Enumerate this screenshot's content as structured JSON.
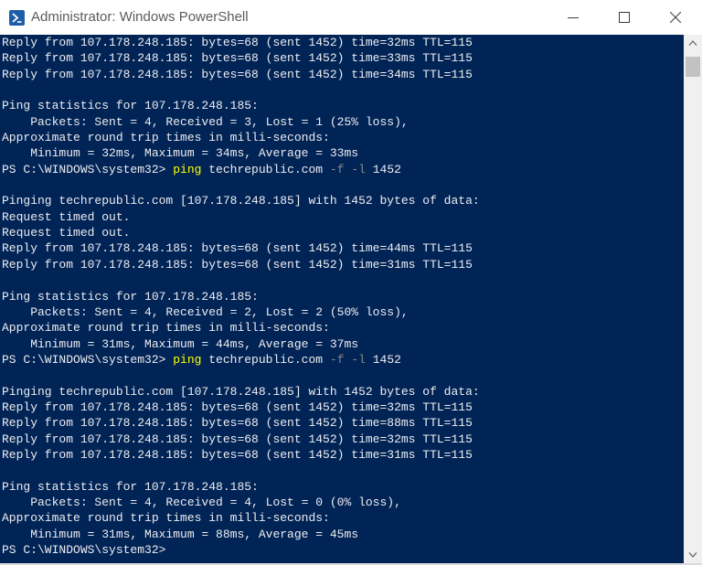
{
  "window": {
    "title": "Administrator: Windows PowerShell",
    "app_icon": "powershell-icon",
    "controls": [
      "minimize-icon",
      "maximize-icon",
      "close-icon"
    ]
  },
  "colors": {
    "console_background": "#012456",
    "console_text": "#eeedf0",
    "command_highlight": "#ffff00",
    "parameter_text": "#8a8a8a"
  },
  "console": {
    "lines": [
      "Reply from 107.178.248.185: bytes=68 (sent 1452) time=32ms TTL=115",
      "Reply from 107.178.248.185: bytes=68 (sent 1452) time=33ms TTL=115",
      "Reply from 107.178.248.185: bytes=68 (sent 1452) time=34ms TTL=115",
      "",
      "Ping statistics for 107.178.248.185:",
      "    Packets: Sent = 4, Received = 3, Lost = 1 (25% loss),",
      "Approximate round trip times in milli-seconds:",
      "    Minimum = 32ms, Maximum = 34ms, Average = 33ms",
      "",
      "",
      "Pinging techrepublic.com [107.178.248.185] with 1452 bytes of data:",
      "Request timed out.",
      "Request timed out.",
      "Reply from 107.178.248.185: bytes=68 (sent 1452) time=44ms TTL=115",
      "Reply from 107.178.248.185: bytes=68 (sent 1452) time=31ms TTL=115",
      "",
      "Ping statistics for 107.178.248.185:",
      "    Packets: Sent = 4, Received = 2, Lost = 2 (50% loss),",
      "Approximate round trip times in milli-seconds:",
      "    Minimum = 31ms, Maximum = 44ms, Average = 37ms",
      "",
      "",
      "Pinging techrepublic.com [107.178.248.185] with 1452 bytes of data:",
      "Reply from 107.178.248.185: bytes=68 (sent 1452) time=32ms TTL=115",
      "Reply from 107.178.248.185: bytes=68 (sent 1452) time=88ms TTL=115",
      "Reply from 107.178.248.185: bytes=68 (sent 1452) time=32ms TTL=115",
      "Reply from 107.178.248.185: bytes=68 (sent 1452) time=31ms TTL=115",
      "",
      "Ping statistics for 107.178.248.185:",
      "    Packets: Sent = 4, Received = 4, Lost = 0 (0% loss),",
      "Approximate round trip times in milli-seconds:",
      "    Minimum = 31ms, Maximum = 88ms, Average = 45ms",
      ""
    ],
    "prompts": [
      {
        "prompt": "PS C:\\WINDOWS\\system32> ",
        "command": "ping",
        "args_before": " techrepublic.com ",
        "param1": "-f",
        "mid": " ",
        "param2": "-l",
        "args_after": " 1452"
      },
      {
        "prompt": "PS C:\\WINDOWS\\system32> ",
        "command": "ping",
        "args_before": " techrepublic.com ",
        "param1": "-f",
        "mid": " ",
        "param2": "-l",
        "args_after": " 1452"
      },
      {
        "prompt": "PS C:\\WINDOWS\\system32>",
        "command": "",
        "args_before": "",
        "param1": "",
        "mid": "",
        "param2": "",
        "args_after": ""
      }
    ]
  }
}
